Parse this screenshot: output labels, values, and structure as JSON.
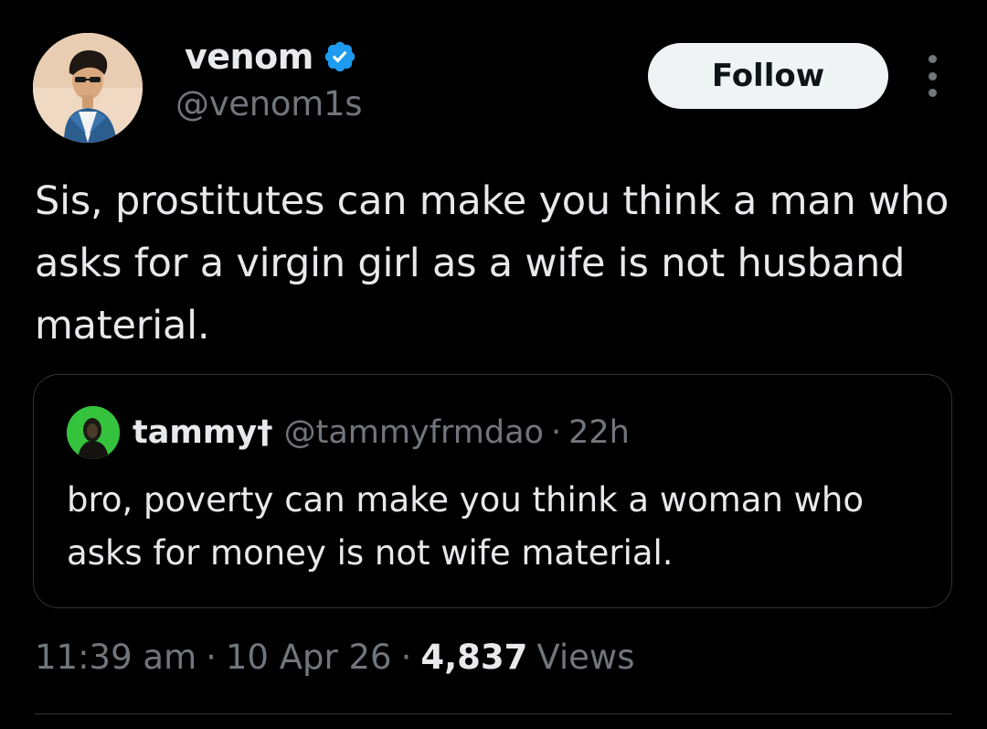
{
  "author": {
    "display_name": "venom",
    "handle": "@venom1s",
    "verified": true,
    "avatar": "user-avatar-photo"
  },
  "actions": {
    "follow_label": "Follow",
    "more_icon": "more-vertical-icon"
  },
  "tweet": {
    "text": "Sis, prostitutes can make you think a man who asks for a virgin girl as a wife is not husband material."
  },
  "quoted_tweet": {
    "display_name": "tammy†",
    "handle": "@tammyfrmdao",
    "separator": "·",
    "time": "22h",
    "text": "bro, poverty can make you think a woman who asks for money is not wife material."
  },
  "meta": {
    "time": "11:39 am",
    "sep1": "·",
    "date": "10 Apr 26",
    "sep2": "·",
    "views_count": "4,837",
    "views_label": "Views"
  },
  "colors": {
    "background": "#000000",
    "text_primary": "#e7e9ea",
    "text_secondary": "#71767b",
    "verified_blue": "#1d9bf0",
    "border": "#2f3336",
    "follow_bg": "#eff3f4"
  }
}
